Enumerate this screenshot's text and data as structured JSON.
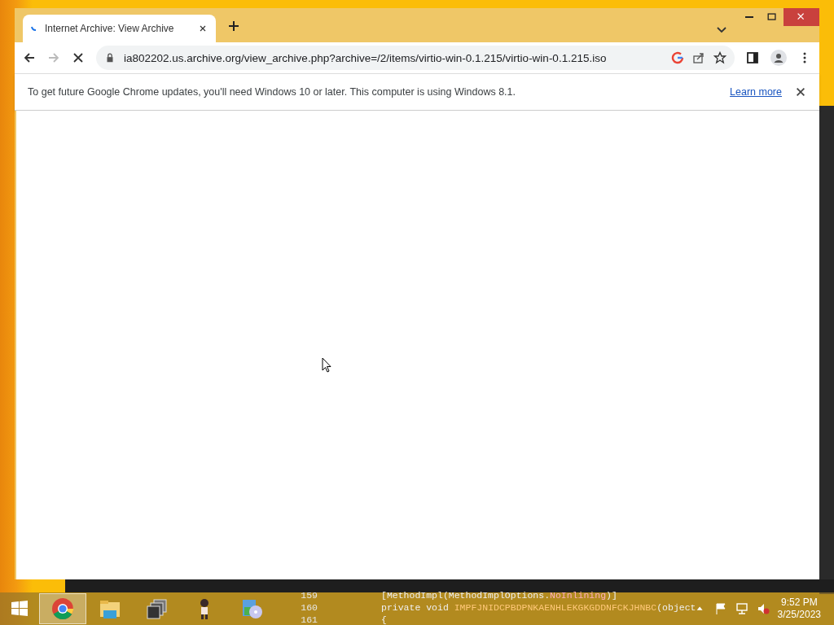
{
  "browser": {
    "tabs": [
      {
        "title": "Internet Archive: View Archive",
        "selected": true
      }
    ],
    "loading": true,
    "address": "ia802202.us.archive.org/view_archive.php?archive=/2/items/virtio-win-0.1.215/virtio-win-0.1.215.iso",
    "infobar": {
      "message": "To get future Google Chrome updates, you'll need Windows 10 or later. This computer is using Windows 8.1.",
      "link": "Learn more"
    }
  },
  "background_editor": {
    "line_numbers": [
      "159",
      "160",
      "161"
    ],
    "lines": [
      [
        {
          "text": "[MethodImpl(MethodImplOptions.",
          "kind": "plain"
        },
        {
          "text": "NoInlining",
          "kind": "attr"
        },
        {
          "text": ")]",
          "kind": "plain"
        }
      ],
      [
        {
          "text": "private void ",
          "kind": "plain"
        },
        {
          "text": "IMPFJNIDCPBDPNKAENHLEKGKGDDNFCKJHNBC",
          "kind": "method"
        },
        {
          "text": "(object",
          "kind": "plain"
        }
      ],
      [
        {
          "text": "{",
          "kind": "plain"
        }
      ]
    ]
  },
  "taskbar": {
    "apps": [
      {
        "kind": "chrome",
        "active": true
      },
      {
        "kind": "folder",
        "active": false
      },
      {
        "kind": "windows",
        "active": false
      },
      {
        "kind": "figure",
        "active": false
      },
      {
        "kind": "setup",
        "active": false
      }
    ],
    "clock": {
      "time": "9:52 PM",
      "date": "3/25/2023"
    }
  }
}
